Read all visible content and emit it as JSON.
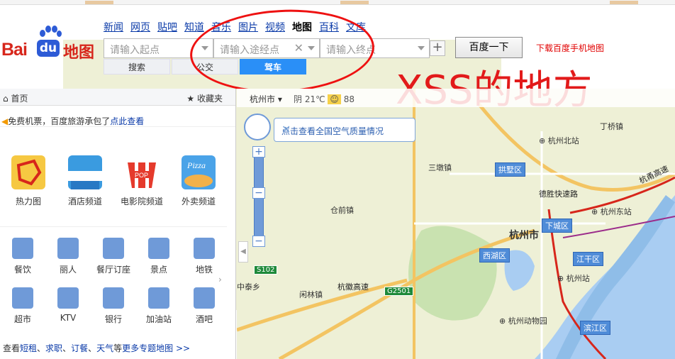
{
  "nav": {
    "links": [
      "新闻",
      "网页",
      "贴吧",
      "知道",
      "音乐",
      "图片",
      "视频",
      "地图",
      "百科",
      "文库"
    ],
    "active": "地图"
  },
  "logo": {
    "bai": "Bai",
    "du": "du",
    "map": "地图"
  },
  "search": {
    "start_placeholder": "请输入起点",
    "via_placeholder": "请输入途经点",
    "end_placeholder": "请输入终点",
    "button": "百度一下",
    "download": "下载百度手机地图",
    "tabs": [
      "搜索",
      "公交",
      "驾车"
    ],
    "selected_tab": "驾车"
  },
  "annotation": {
    "text": "XSS的地方",
    "color": "#e21a1a"
  },
  "left": {
    "home": "首页",
    "favorites": "收藏夹",
    "promo_text": "免费机票，百度旅游承包了",
    "promo_link": "点此查看",
    "big_icons": [
      {
        "label": "热力图",
        "icon": "heatmap-icon"
      },
      {
        "label": "酒店频道",
        "icon": "hotel-icon"
      },
      {
        "label": "电影院频道",
        "icon": "cinema-icon"
      },
      {
        "label": "外卖频道",
        "icon": "pizza-icon"
      }
    ],
    "small_icons_row1": [
      "餐饮",
      "丽人",
      "餐厅订座",
      "景点",
      "地铁"
    ],
    "small_icons_row2": [
      "超市",
      "KTV",
      "银行",
      "加油站",
      "酒吧"
    ],
    "more_prefix": "查看",
    "more_links": [
      "短租",
      "求职",
      "订餐",
      "天气"
    ],
    "more_suffix": "等",
    "more_link": "更多专题地图 >>"
  },
  "map": {
    "city": "杭州市",
    "weather": "阴 21℃",
    "aqi": "88",
    "air_quality": "点击查看全国空气质量情况",
    "labels": [
      "三墩镇",
      "仓前镇",
      "闲林镇",
      "中泰乡",
      "杭州市",
      "丁桥镇",
      "杭徽高速",
      "德胜快速路",
      "杭州北站",
      "杭州东站",
      "杭州站",
      "杭州动物园",
      "杭甬高速"
    ],
    "districts": [
      "拱墅区",
      "下城区",
      "西湖区",
      "江干区",
      "滨江区"
    ],
    "roads": [
      "S102",
      "G2501"
    ]
  }
}
